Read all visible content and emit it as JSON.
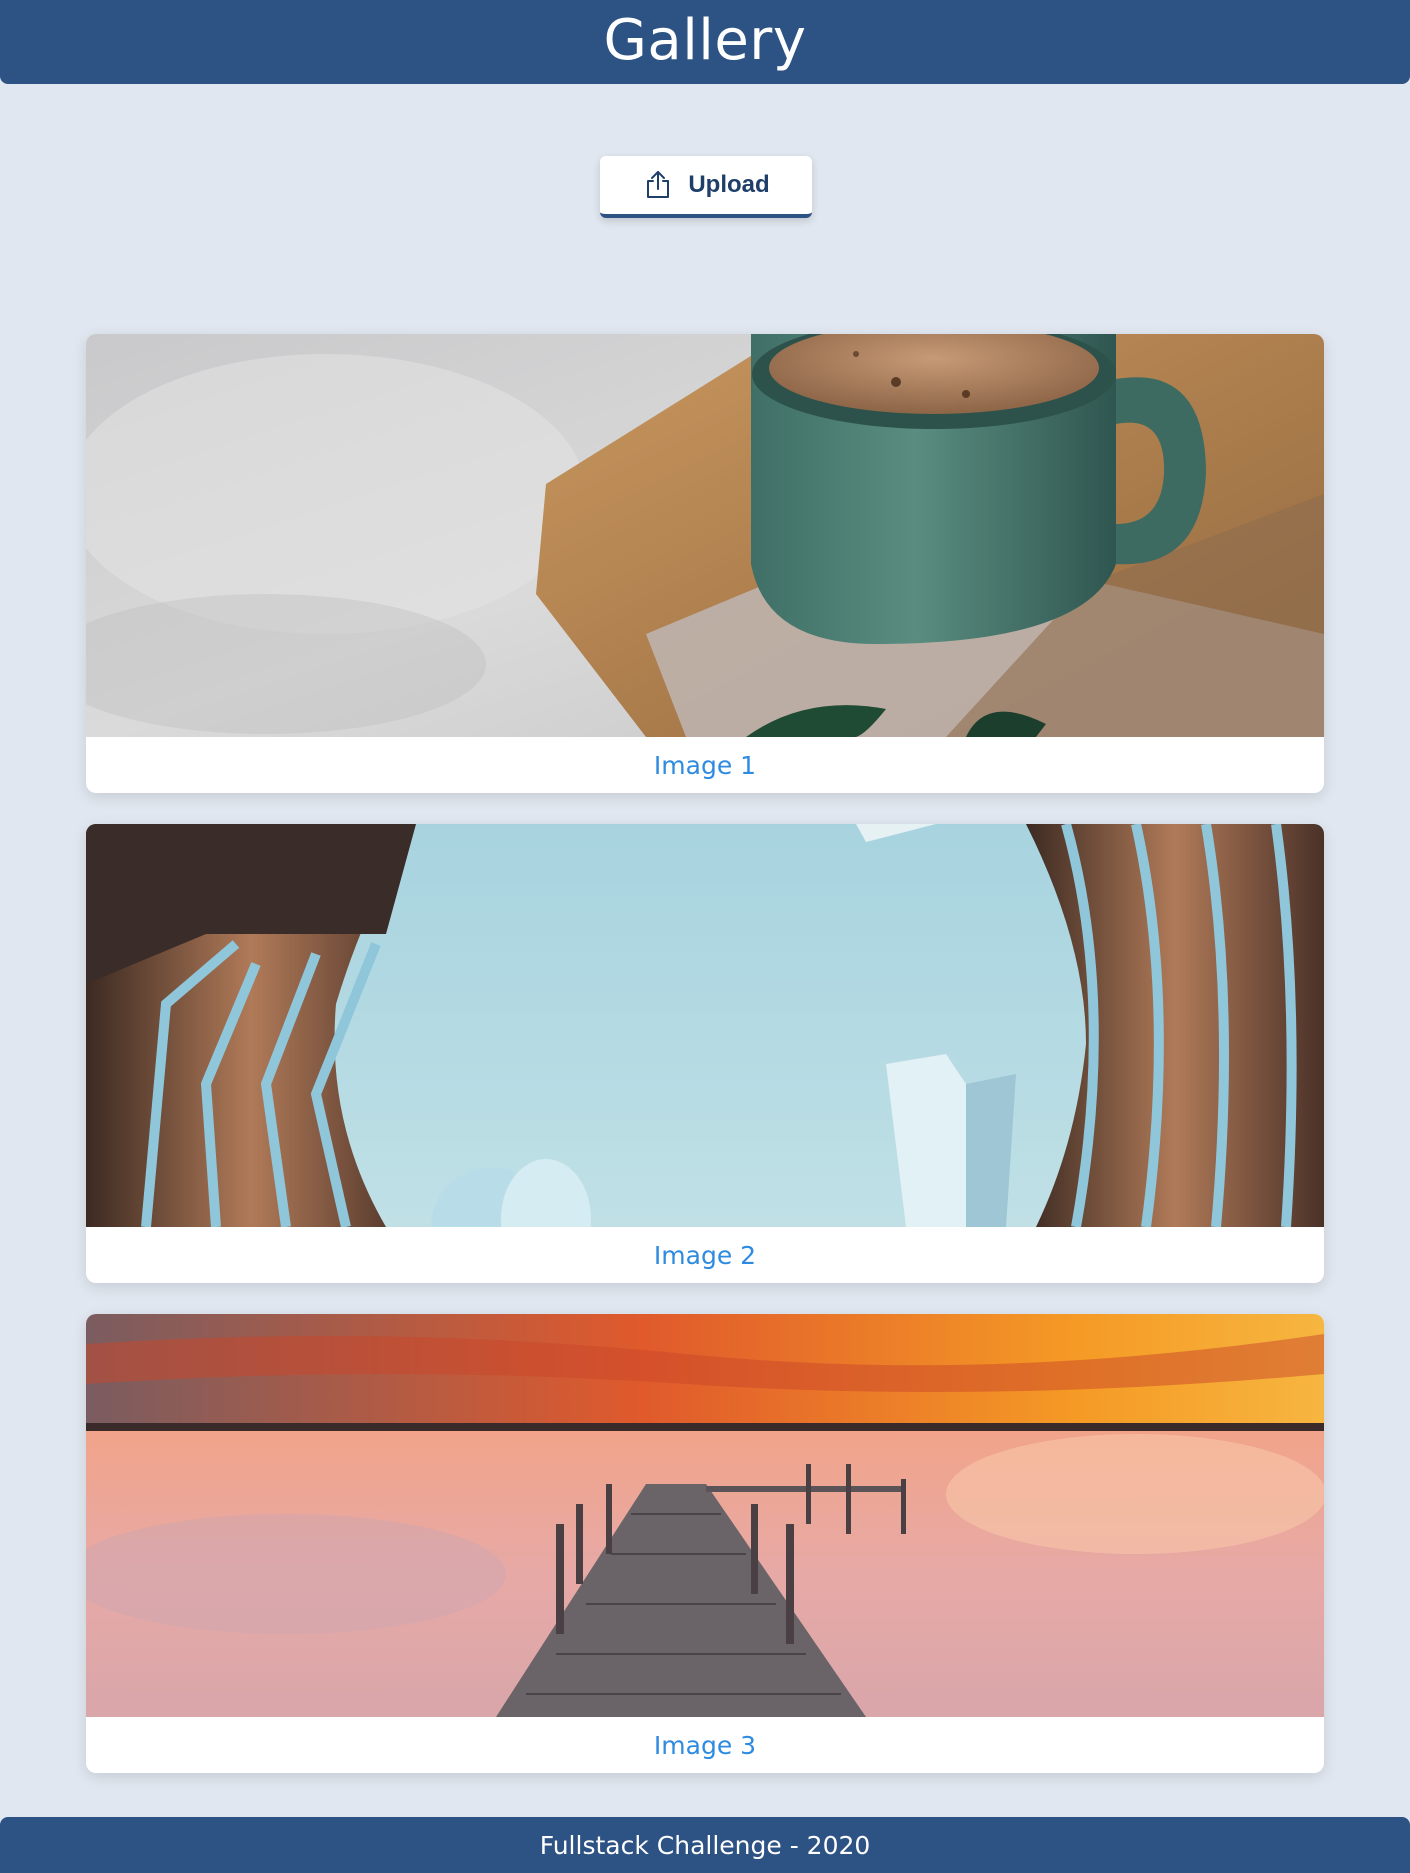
{
  "header": {
    "title": "Gallery"
  },
  "toolbar": {
    "upload_label": "Upload",
    "upload_icon": "upload-icon"
  },
  "gallery": {
    "items": [
      {
        "caption": "Image 1",
        "subject": "coffee-mug"
      },
      {
        "caption": "Image 2",
        "subject": "skyscrapers"
      },
      {
        "caption": "Image 3",
        "subject": "sunset-pier"
      }
    ]
  },
  "footer": {
    "text": "Fullstack Challenge - 2020"
  },
  "colors": {
    "primary": "#2d5284",
    "background": "#e1e7f0",
    "caption": "#2f8be0",
    "card": "#ffffff"
  }
}
